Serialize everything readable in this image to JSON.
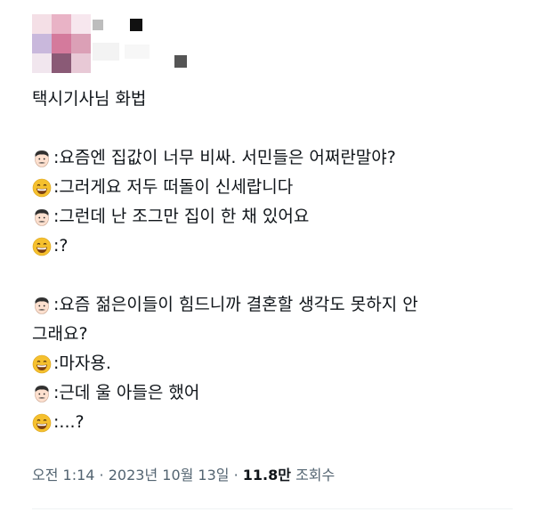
{
  "tweet": {
    "title": "택시기사님 화법",
    "paragraphs": [
      [
        {
          "speaker": "man-face-icon",
          "text": ":요즘엔 집값이 너무 비싸. 서민들은 어쩌란말야?"
        },
        {
          "speaker": "grinning-face-icon",
          "text": ":그러게요 저두 떠돌이 신세랍니다"
        },
        {
          "speaker": "man-face-icon",
          "text": ":그런데 난 조그만 집이 한 채 있어요"
        },
        {
          "speaker": "grinning-face-icon",
          "text": ":?"
        }
      ],
      [
        {
          "speaker": "man-face-icon",
          "text": ":요즘 젊은이들이 힘드니까 결혼할 생각도 못하지 안"
        },
        {
          "speaker": "",
          "text": "그래요?"
        },
        {
          "speaker": "grinning-face-icon",
          "text": ":마자용."
        },
        {
          "speaker": "man-face-icon",
          "text": ":근데 울 아들은 했어"
        },
        {
          "speaker": "grinning-face-icon",
          "text": ":...?"
        }
      ]
    ],
    "meta": {
      "time": "오전 1:14",
      "separator1": " · ",
      "date": "2023년 10월 13일",
      "separator2": " · ",
      "views_count": "11.8만",
      "views_label": " 조회수"
    }
  },
  "colors": {
    "text": "#0f1419",
    "meta_text": "#536471",
    "emoji_yellow": "#f5c02e",
    "skin": "#fde0cf"
  }
}
